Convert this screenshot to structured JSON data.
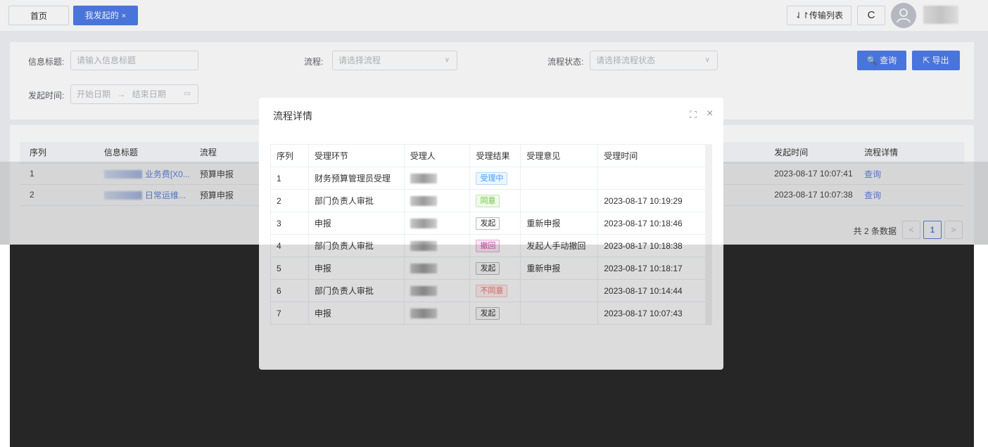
{
  "tabs": {
    "home": "首页",
    "active": "我发起的",
    "active_close": "×"
  },
  "header": {
    "transfer_list": "⇃↾传输列表",
    "refresh": "C"
  },
  "filters": {
    "title_label": "信息标题:",
    "title_placeholder": "请输入信息标题",
    "process_label": "流程:",
    "process_placeholder": "请选择流程",
    "status_label": "流程状态:",
    "status_placeholder": "请选择流程状态",
    "time_label": "发起时间:",
    "start_date": "开始日期",
    "date_arrow": "→",
    "end_date": "结束日期",
    "query_button": "🔍 查询",
    "export_button": "⇱ 导出"
  },
  "main_table": {
    "columns": [
      "序列",
      "信息标题",
      "流程",
      "发起时间",
      "流程详情"
    ],
    "rows": [
      {
        "index": "1",
        "title": "业务费[X0...",
        "process": "预算申报",
        "time": "2023-08-17 10:07:41",
        "detail": "查询"
      },
      {
        "index": "2",
        "title": "日常运维...",
        "process": "预算申报",
        "time": "2023-08-17 10:07:38",
        "detail": "查询"
      }
    ]
  },
  "pagination": {
    "total": "共 2 条数据",
    "prev": "<",
    "current": "1",
    "next": ">"
  },
  "modal": {
    "title": "流程详情",
    "fullscreen": "⛶",
    "close": "×",
    "columns": [
      "序列",
      "受理环节",
      "受理人",
      "受理结果",
      "受理意见",
      "受理时间"
    ],
    "rows": [
      {
        "index": "1",
        "step": "财务预算管理员受理",
        "result": "受理中",
        "result_type": "processing",
        "opinion": "",
        "time": ""
      },
      {
        "index": "2",
        "step": "部门负责人审批",
        "result": "同意",
        "result_type": "agree",
        "opinion": "",
        "time": "2023-08-17 10:19:29"
      },
      {
        "index": "3",
        "step": "申报",
        "result": "发起",
        "result_type": "start",
        "opinion": "重新申报",
        "time": "2023-08-17 10:18:46"
      },
      {
        "index": "4",
        "step": "部门负责人审批",
        "result": "撤回",
        "result_type": "withdraw",
        "opinion": "发起人手动撤回",
        "time": "2023-08-17 10:18:38"
      },
      {
        "index": "5",
        "step": "申报",
        "result": "发起",
        "result_type": "start",
        "opinion": "重新申报",
        "time": "2023-08-17 10:18:17"
      },
      {
        "index": "6",
        "step": "部门负责人审批",
        "result": "不同意",
        "result_type": "disagree",
        "opinion": "",
        "time": "2023-08-17 10:14:44"
      },
      {
        "index": "7",
        "step": "申报",
        "result": "发起",
        "result_type": "start",
        "opinion": "",
        "time": "2023-08-17 10:07:43"
      }
    ]
  },
  "colors": {
    "primary": "#4e7ce8",
    "processing": "#409eff",
    "agree": "#67c23a",
    "withdraw": "#c94fa8",
    "disagree": "#f56c6c"
  }
}
